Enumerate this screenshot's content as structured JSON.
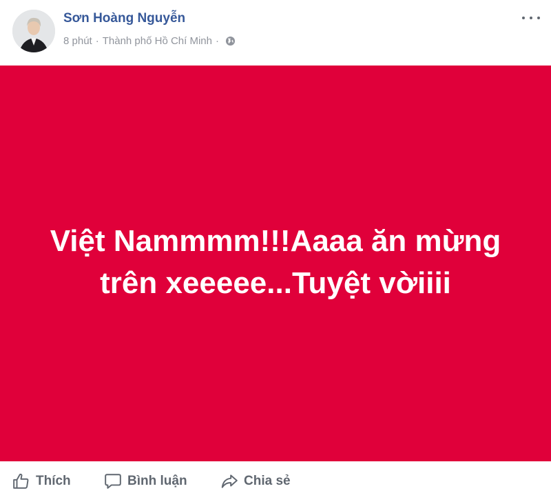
{
  "post": {
    "author": "Sơn Hoàng Nguyễn",
    "time": "8 phút",
    "separator1": "·",
    "location": "Thành phố Hồ Chí Minh",
    "separator2": "·",
    "message": "Việt Nammmm!!!Aaaa ăn mừng trên xeeeee...Tuyệt vờiiii",
    "background_color": "#e0003a",
    "text_color": "#ffffff"
  },
  "actions": {
    "like_label": "Thích",
    "comment_label": "Bình luận",
    "share_label": "Chia sẻ"
  },
  "colors": {
    "author_name": "#365899",
    "meta_text": "#90949c",
    "action_text": "#606770"
  },
  "icons": {
    "globe": "globe-icon",
    "like": "thumbs-up-icon",
    "comment": "comment-bubble-icon",
    "share": "share-arrow-icon",
    "more": "more-options-icon"
  }
}
